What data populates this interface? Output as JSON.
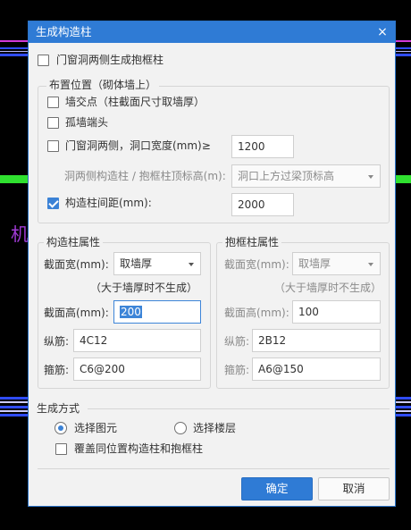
{
  "background": {
    "text": "机"
  },
  "dialog": {
    "title": "生成构造柱",
    "close_glyph": "×"
  },
  "top_option": {
    "label": "门窗洞两侧生成抱框柱",
    "checked": false
  },
  "placement": {
    "title": "布置位置（砌体墙上）",
    "wall_intersection": {
      "label": "墙交点（柱截面尺寸取墙厚）",
      "checked": false
    },
    "isolated_wall_end": {
      "label": "孤墙端头",
      "checked": false
    },
    "door_window_sides": {
      "label": "门窗洞两侧，洞口宽度(mm)≥",
      "checked": false,
      "value": "1200"
    },
    "top_elevation": {
      "label": "洞两侧构造柱 / 抱框柱顶标高(m):",
      "value": "洞口上方过梁顶标高"
    },
    "spacing": {
      "label": "构造柱间距(mm):",
      "checked": true,
      "value": "2000"
    }
  },
  "column_props": {
    "title": "构造柱属性",
    "width_label": "截面宽(mm):",
    "width_value": "取墙厚",
    "note": "（大于墙厚时不生成）",
    "height_label": "截面高(mm):",
    "height_value": "200",
    "long_rebar_label": "纵筋:",
    "long_rebar_value": "4C12",
    "stirrup_label": "箍筋:",
    "stirrup_value": "C6@200"
  },
  "frame_props": {
    "title": "抱框柱属性",
    "width_label": "截面宽(mm):",
    "width_value": "取墙厚",
    "note": "（大于墙厚时不生成）",
    "height_label": "截面高(mm):",
    "height_value": "100",
    "long_rebar_label": "纵筋:",
    "long_rebar_value": "2B12",
    "stirrup_label": "箍筋:",
    "stirrup_value": "A6@150"
  },
  "generation": {
    "title": "生成方式",
    "select_elements": {
      "label": "选择图元",
      "selected": true
    },
    "select_floors": {
      "label": "选择楼层",
      "selected": false
    },
    "overwrite": {
      "label": "覆盖同位置构造柱和抱框柱",
      "checked": false
    }
  },
  "buttons": {
    "ok": "确定",
    "cancel": "取消"
  },
  "colors": {
    "title_bar": "#2f7bd5",
    "accent": "#3b82d6",
    "dialog_bg": "#f2f2f2",
    "cad_green": "#2fe02f",
    "cad_blue": "#2f4cff",
    "cad_purple": "#a23bd6"
  }
}
